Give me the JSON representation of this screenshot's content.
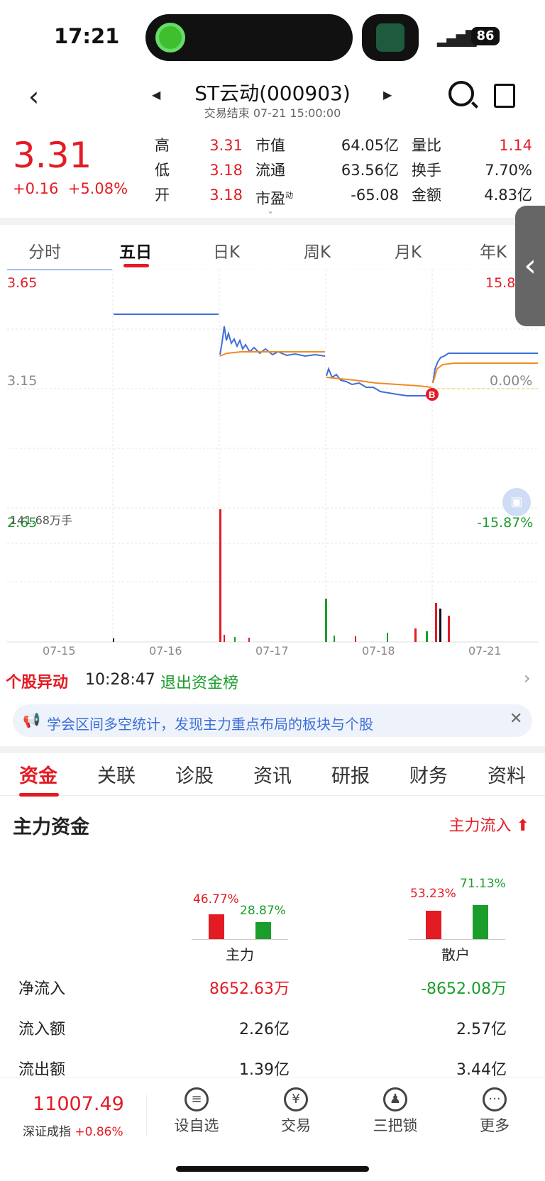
{
  "status_bar": {
    "time": "17:21",
    "battery": "86"
  },
  "header": {
    "stock_name": "ST云动(000903)",
    "status_line": "交易结束 07-21 15:00:00"
  },
  "quote": {
    "price": "3.31",
    "change": "+0.16",
    "change_pct": "+5.08%",
    "fields": [
      {
        "label": "高",
        "value": "3.31"
      },
      {
        "label": "低",
        "value": "3.18"
      },
      {
        "label": "开",
        "value": "3.18"
      }
    ],
    "fields2": [
      {
        "label": "市值",
        "value": "64.05亿"
      },
      {
        "label": "流通",
        "value": "63.56亿"
      },
      {
        "label": "市盈",
        "value": "-65.08",
        "sup": "动"
      }
    ],
    "fields3": [
      {
        "label": "量比",
        "value": "1.14"
      },
      {
        "label": "换手",
        "value": "7.70%"
      },
      {
        "label": "金额",
        "value": "4.83亿"
      }
    ]
  },
  "period_tabs": [
    "分时",
    "五日",
    "日K",
    "周K",
    "月K",
    "年K"
  ],
  "chart_data": {
    "type": "line",
    "title": "",
    "x_dates": [
      "07-15",
      "07-16",
      "07-17",
      "07-18",
      "07-21"
    ],
    "ylim": [
      2.65,
      3.65
    ],
    "y_labels_left": [
      "3.65",
      "3.15",
      "2.65"
    ],
    "y_labels_right": [
      "15.8",
      "0.00%",
      "-15.87%"
    ],
    "volume_label": "141.68万手",
    "series": [],
    "marker": "B",
    "colors": {
      "price_line": "#3d6fd8",
      "avg_line": "#f08a24",
      "up": "#e31b23",
      "down": "#1a9d2b"
    }
  },
  "alert": {
    "tag": "个股异动",
    "time": "10:28:47",
    "text": "退出资金榜"
  },
  "tip": {
    "text": "学会区间多空统计，发现主力重点布局的板块与个股"
  },
  "sub_tabs": [
    "资金",
    "关联",
    "诊股",
    "资讯",
    "研报",
    "财务",
    "资料"
  ],
  "fund": {
    "title": "主力资金",
    "flow_label": "主力流入",
    "groups": [
      {
        "name": "主力",
        "in_pct": "46.77%",
        "out_pct": "28.87%",
        "in_val": 46.77,
        "out_val": 28.87
      },
      {
        "name": "散户",
        "in_pct": "53.23%",
        "out_pct": "71.13%",
        "in_val": 53.23,
        "out_val": 71.13
      }
    ],
    "rows": [
      {
        "label": "净流入",
        "main": "8652.63万",
        "retail": "-8652.08万"
      },
      {
        "label": "流入额",
        "main": "2.26亿",
        "retail": "2.57亿"
      },
      {
        "label": "流出额",
        "main": "1.39亿",
        "retail": "3.44亿"
      }
    ]
  },
  "bottom": {
    "index_value": "11007.49",
    "index_name": "深证成指",
    "index_change": "+0.86%",
    "nav": [
      {
        "label": "设自选",
        "icon": "list-icon"
      },
      {
        "label": "交易",
        "icon": "yen-icon"
      },
      {
        "label": "三把锁",
        "icon": "lock-icon"
      },
      {
        "label": "更多",
        "icon": "more-icon"
      }
    ]
  }
}
